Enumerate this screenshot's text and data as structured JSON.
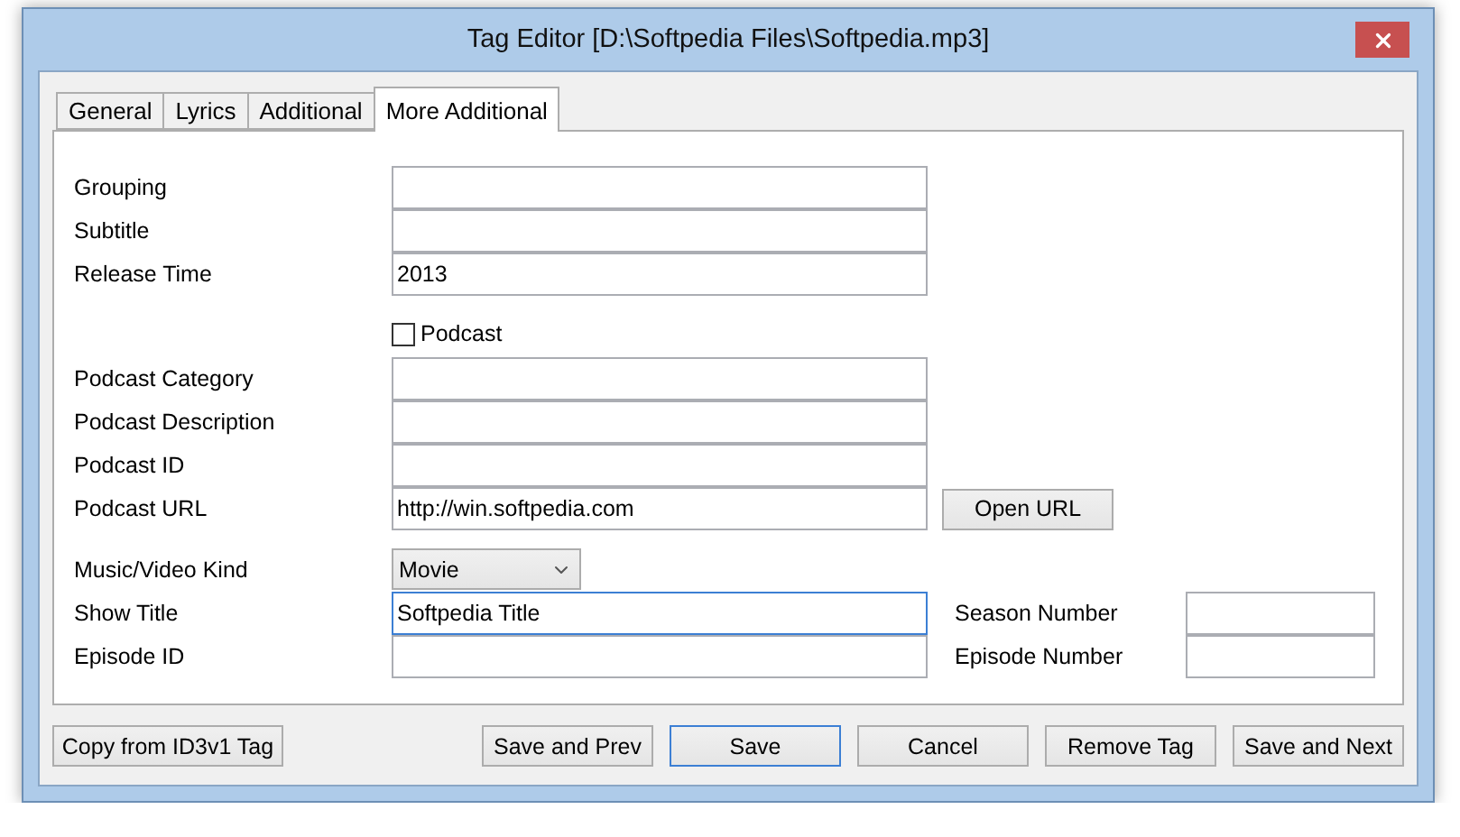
{
  "window": {
    "title": "Tag Editor [D:\\Softpedia Files\\Softpedia.mp3]"
  },
  "tabs": [
    {
      "label": "General",
      "selected": false
    },
    {
      "label": "Lyrics",
      "selected": false
    },
    {
      "label": "Additional",
      "selected": false
    },
    {
      "label": "More Additional",
      "selected": true
    }
  ],
  "sections": [
    {
      "rows": [
        {
          "kind": "text",
          "label": "Grouping",
          "focused": false
        },
        {
          "kind": "text",
          "label": "Subtitle",
          "focused": false
        },
        {
          "kind": "text",
          "label": "Release Time",
          "value": "2013",
          "focused": false
        }
      ]
    },
    {
      "rows": [
        {
          "kind": "checkbox",
          "label": "Podcast",
          "checked": false
        },
        {
          "kind": "text",
          "label": "Podcast Category",
          "focused": false
        },
        {
          "kind": "text",
          "label": "Podcast Description",
          "focused": false
        },
        {
          "kind": "text",
          "label": "Podcast ID",
          "focused": false
        },
        {
          "kind": "text",
          "label": "Podcast URL",
          "value": "http://win.softpedia.com",
          "focused": false,
          "button": "Open URL"
        }
      ]
    },
    {
      "rows": [
        {
          "kind": "select",
          "label": "Music/Video Kind",
          "value": "Movie"
        },
        {
          "kind": "text",
          "label": "Show Title",
          "value": "Softpedia Title",
          "focused": true,
          "side": {
            "label": "Season Number"
          }
        },
        {
          "kind": "text",
          "label": "Episode ID",
          "focused": false,
          "side": {
            "label": "Episode Number"
          }
        }
      ]
    }
  ],
  "left_button": {
    "label": "Copy from ID3v1 Tag"
  },
  "buttons": [
    {
      "label": "Save and Prev",
      "default": false
    },
    {
      "label": "Save",
      "default": true
    },
    {
      "label": "Cancel",
      "default": false
    },
    {
      "label": "Remove Tag",
      "default": false
    },
    {
      "label": "Save and Next",
      "default": false
    }
  ]
}
